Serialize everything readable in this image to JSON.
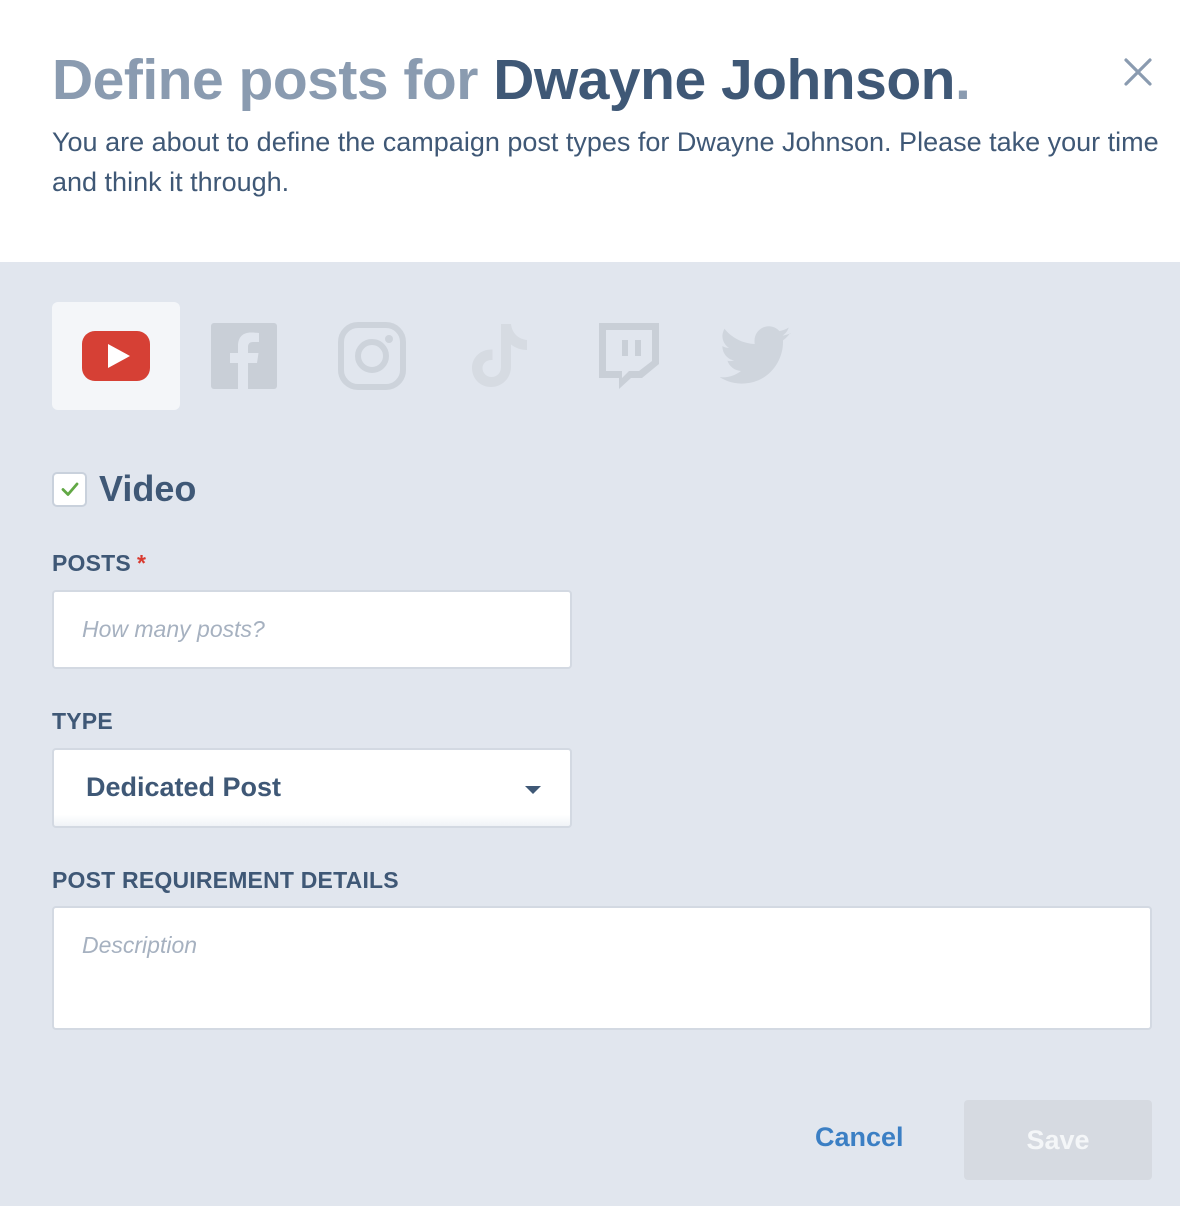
{
  "header": {
    "title_lead": "Define posts for ",
    "title_name": "Dwayne Johnson",
    "title_dot": ".",
    "subtitle": "You are about to define the campaign post types for Dwayne Johnson. Please take your time and think it through."
  },
  "platforms": [
    {
      "name": "youtube-icon",
      "selected": true
    },
    {
      "name": "facebook-icon",
      "selected": false
    },
    {
      "name": "instagram-icon",
      "selected": false
    },
    {
      "name": "tiktok-icon",
      "selected": false
    },
    {
      "name": "twitch-icon",
      "selected": false
    },
    {
      "name": "twitter-icon",
      "selected": false
    }
  ],
  "colors": {
    "youtube": "#d64035",
    "inactive_icon": "#c9cfd7",
    "accent_blue": "#3b7fc4",
    "required": "#d93a2f",
    "check": "#62a845"
  },
  "video": {
    "label": "Video",
    "checked": true
  },
  "posts": {
    "label": "POSTS",
    "required_mark": "*",
    "placeholder": "How many posts?"
  },
  "type": {
    "label": "TYPE",
    "value": "Dedicated Post"
  },
  "details": {
    "label": "POST REQUIREMENT DETAILS",
    "placeholder": "Description"
  },
  "actions": {
    "cancel": "Cancel",
    "save": "Save"
  }
}
